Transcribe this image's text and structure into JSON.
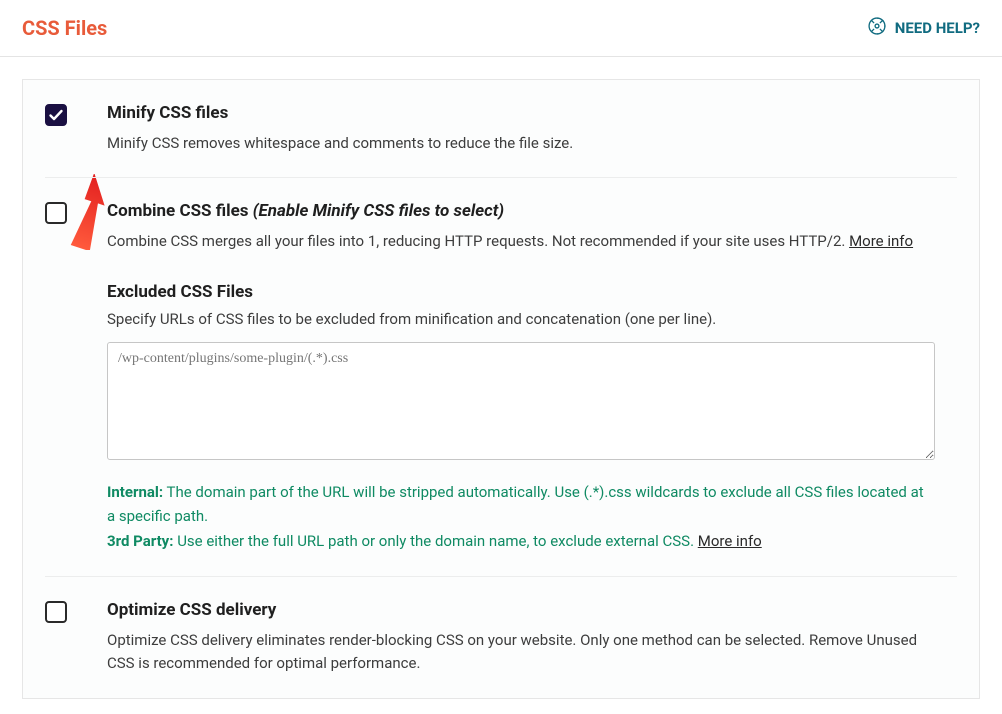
{
  "header": {
    "title": "CSS Files",
    "help": "NEED HELP?"
  },
  "options": {
    "minify": {
      "title": "Minify CSS files",
      "desc": "Minify CSS removes whitespace and comments to reduce the file size."
    },
    "combine": {
      "title": "Combine CSS files",
      "suffix": "(Enable Minify CSS files to select)",
      "desc": "Combine CSS merges all your files into 1, reducing HTTP requests. Not recommended if your site uses HTTP/2. ",
      "more": "More info"
    },
    "excluded": {
      "title": "Excluded CSS Files",
      "desc": "Specify URLs of CSS files to be excluded from minification and concatenation (one per line).",
      "placeholder": "/wp-content/plugins/some-plugin/(.*).css",
      "hint_internal_label": "Internal:",
      "hint_internal": " The domain part of the URL will be stripped automatically. Use (.*).css wildcards to exclude all CSS files located at a specific path.",
      "hint_3rd_label": "3rd Party:",
      "hint_3rd": " Use either the full URL path or only the domain name, to exclude external CSS. ",
      "more": "More info"
    },
    "optimize": {
      "title": "Optimize CSS delivery",
      "desc": "Optimize CSS delivery eliminates render-blocking CSS on your website. Only one method can be selected. Remove Unused CSS is recommended for optimal performance."
    }
  }
}
